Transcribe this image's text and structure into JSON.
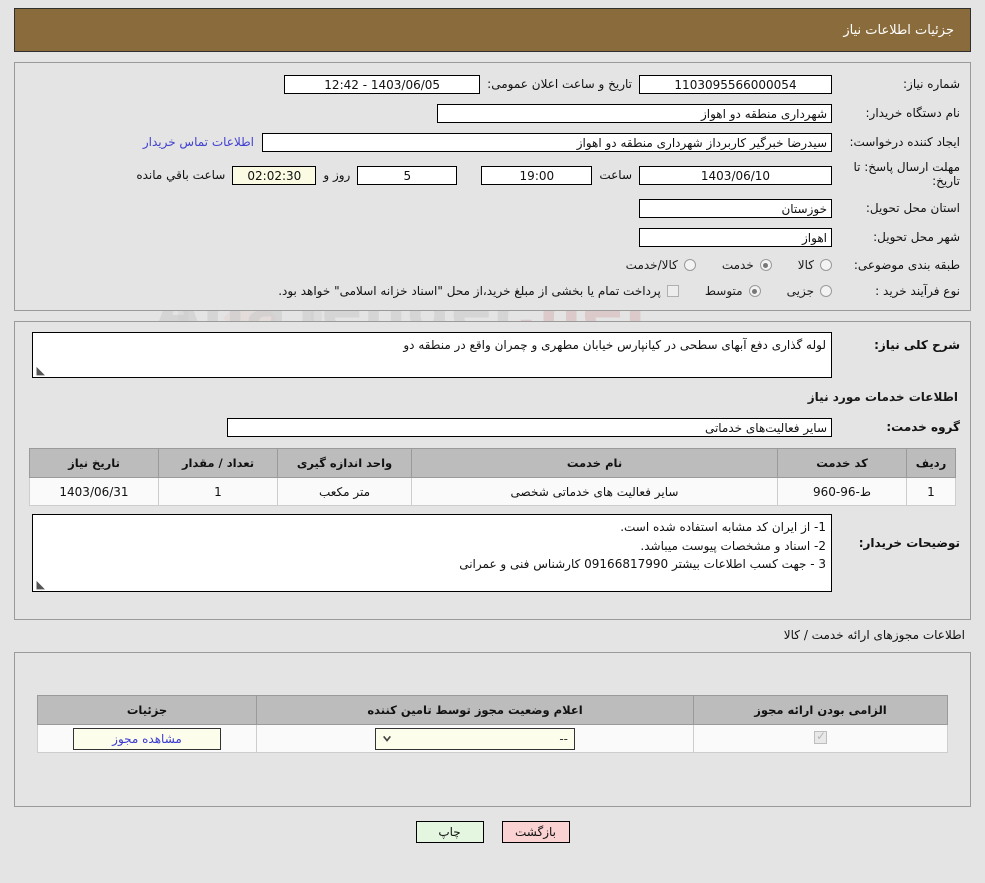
{
  "header": {
    "title": "جزئیات اطلاعات نیاز"
  },
  "watermark": {
    "text": "AnaTender",
    "suffix": ".net"
  },
  "form": {
    "need_number_label": "شماره نیاز:",
    "need_number_value": "1103095566000054",
    "announce_label": "تاریخ و ساعت اعلان عمومی:",
    "announce_value": "1403/06/05 - 12:42",
    "buyer_org_label": "نام دستگاه خریدار:",
    "buyer_org_value": "شهرداری منطقه دو اهواز",
    "creator_label": "ایجاد کننده درخواست:",
    "creator_value": "سیدرضا خبرگیر کاربرداز  شهرداری منطقه دو اهواز",
    "contact_link": "اطلاعات تماس خریدار",
    "deadline_label": "مهلت ارسال پاسخ: تا تاریخ:",
    "deadline_date": "1403/06/10",
    "hour_label": "ساعت",
    "deadline_time": "19:00",
    "days_value": "5",
    "days_label": "روز و",
    "remaining_clock": "02:02:30",
    "remaining_label": "ساعت باقي مانده",
    "province_label": "استان محل تحویل:",
    "province_value": "خوزستان",
    "city_label": "شهر محل تحویل:",
    "city_value": "اهواز",
    "category_label": "طبقه بندی موضوعی:",
    "category_options": [
      {
        "label": "کالا",
        "selected": false
      },
      {
        "label": "خدمت",
        "selected": true
      },
      {
        "label": "کالا/خدمت",
        "selected": false
      }
    ],
    "process_label": "نوع فرآیند خرید :",
    "process_options": [
      {
        "label": "جزیی",
        "selected": false
      },
      {
        "label": "متوسط",
        "selected": true
      }
    ],
    "treasury_note": "پرداخت تمام یا بخشی از مبلغ خرید،از محل \"اسناد خزانه اسلامی\" خواهد بود."
  },
  "description": {
    "label": "شرح کلی نیاز:",
    "value": "لوله گذاری دفع آبهای سطحی در کیانپارس خیابان مطهری و چمران واقع در منطقه دو"
  },
  "services": {
    "section_title": "اطلاعات خدمات مورد نیاز",
    "group_label": "گروه خدمت:",
    "group_value": "سایر فعالیت‌های خدماتی",
    "columns": [
      "ردیف",
      "کد خدمت",
      "نام خدمت",
      "واحد اندازه گیری",
      "تعداد / مقدار",
      "تاریخ نیاز"
    ],
    "rows": [
      {
        "index": "1",
        "code": "ط-96-960",
        "name": "سایر فعالیت های خدماتی شخصی",
        "unit": "متر مکعب",
        "qty": "1",
        "need_date": "1403/06/31"
      }
    ]
  },
  "buyer_notes": {
    "label": "توضیحات خریدار:",
    "lines": [
      "1- از ایران کد مشابه استفاده شده است.",
      "2- اسناد و مشخصات پیوست میباشد.",
      "3 - جهت کسب اطلاعات بیشتر 09166817990 کارشناس فنی و عمرانی"
    ]
  },
  "permits": {
    "caption": "اطلاعات مجوزهای ارائه خدمت / کالا",
    "columns": [
      "الزامی بودن ارائه مجوز",
      "اعلام وضعیت مجوز توسط تامین کننده",
      "جزئیات"
    ],
    "rows": [
      {
        "required": true,
        "status_value": "--",
        "details_button": "مشاهده مجوز"
      }
    ]
  },
  "footer": {
    "back_label": "بازگشت",
    "print_label": "چاپ"
  },
  "colors": {
    "header_bar": "#8a6b3b",
    "page_bg": "#e4e4e4",
    "link": "#4141d0",
    "back_btn": "#fbd2d2",
    "print_btn": "#e4f6e0",
    "table_header": "#bcbcbc",
    "cream_field": "#fbfbe4"
  }
}
